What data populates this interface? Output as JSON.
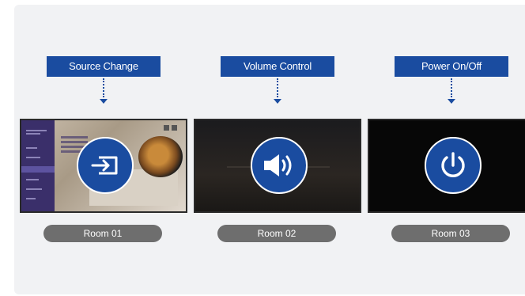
{
  "rooms": [
    {
      "action_label": "Source Change",
      "icon": "source-change-icon",
      "room_label": "Room 01"
    },
    {
      "action_label": "Volume Control",
      "icon": "volume-icon",
      "room_label": "Room 02"
    },
    {
      "action_label": "Power On/Off",
      "icon": "power-icon",
      "room_label": "Room 03"
    }
  ],
  "colors": {
    "accent": "#1a4ca0",
    "pill": "#6e6e6e",
    "stage": "#f1f2f4"
  }
}
